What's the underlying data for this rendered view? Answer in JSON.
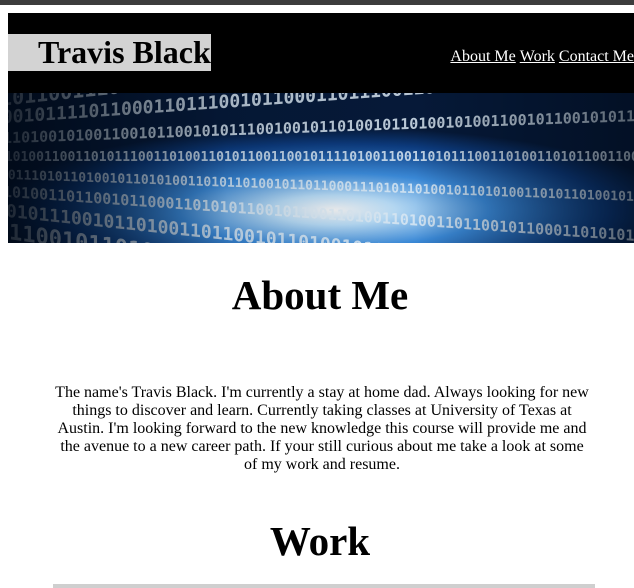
{
  "header": {
    "title": "Travis Black",
    "nav": [
      "About Me",
      "Work",
      "Contact Me"
    ]
  },
  "banner": {
    "rows": [
      "0101100111001100010110111000110101100111000",
      "1001011110110001101110010110001101110011010",
      "0110100101001100101100101011100100101101001",
      "1101001100110101110011010011010110011001011",
      "0011101011010010110101001101011010010110110",
      "1010011011001011000110101011001011001101001",
      "0101110010110100110110010110100101101100101",
      "1100101101001011001011101001011010010110110"
    ]
  },
  "about": {
    "title": "About Me",
    "text": "The name's Travis Black. I'm currently a stay at home dad. Always looking for new things to discover and learn. Currently taking classes at University of Texas at Austin. I'm looking forward to the new knowledge this course will provide me and the avenue to a new career path. If your still curious about me take a look at some of my work and resume."
  },
  "work": {
    "title": "Work"
  },
  "colors": {
    "header_bg": "#000000",
    "brand_bg": "#d3d3d3",
    "banner_blue": "#1a5fb4",
    "banner_light": "#bfe4ff"
  }
}
